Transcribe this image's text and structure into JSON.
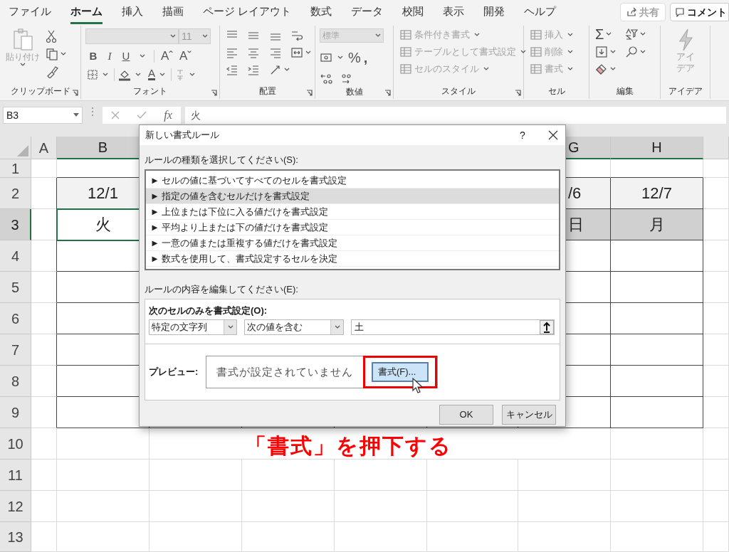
{
  "ribbon_tabs": [
    {
      "label": "ファイル",
      "selected": false
    },
    {
      "label": "ホーム",
      "selected": true
    },
    {
      "label": "挿入",
      "selected": false
    },
    {
      "label": "描画",
      "selected": false
    },
    {
      "label": "ページ レイアウト",
      "selected": false
    },
    {
      "label": "数式",
      "selected": false
    },
    {
      "label": "データ",
      "selected": false
    },
    {
      "label": "校閲",
      "selected": false
    },
    {
      "label": "表示",
      "selected": false
    },
    {
      "label": "開発",
      "selected": false
    },
    {
      "label": "ヘルプ",
      "selected": false
    }
  ],
  "share_button": {
    "label": "共有",
    "disabled": true
  },
  "comment_button": {
    "label": "コメント"
  },
  "ribbon": {
    "clipboard": {
      "paste": {
        "label": "貼り付け",
        "disabled": true
      },
      "group_label": "クリップボード"
    },
    "font": {
      "size": "11",
      "style_buttons": [
        "B",
        "I",
        "U"
      ],
      "size_buttons": [
        "Aˆ",
        "Aˇ"
      ],
      "color_button": "A",
      "group_label": "フォント"
    },
    "alignment": {
      "group_label": "配置"
    },
    "number": {
      "format": "標準",
      "symbols": [
        "%",
        ","
      ],
      "group_label": "数値"
    },
    "styles": {
      "commands": [
        {
          "label": "条件付き書式",
          "disabled": true
        },
        {
          "label": "テーブルとして書式設定",
          "disabled": true
        },
        {
          "label": "セルのスタイル",
          "disabled": true
        }
      ],
      "group_label": "スタイル"
    },
    "cells": {
      "commands": [
        {
          "label": "挿入",
          "disabled": true
        },
        {
          "label": "削除",
          "disabled": true
        },
        {
          "label": "書式",
          "disabled": true
        }
      ],
      "group_label": "セル"
    },
    "editing": {
      "sum": "Σ",
      "group_label": "編集"
    },
    "ideas": {
      "label": "アイデア",
      "disabled": true,
      "group_label": "アイデア"
    }
  },
  "formula_bar": {
    "name_box": "B3",
    "fx_label": "fx",
    "formula": "火"
  },
  "sheet": {
    "columns": [
      {
        "label": "A",
        "selected": false
      },
      {
        "label": "B",
        "selected": true
      },
      {
        "label": "G",
        "selected": true
      },
      {
        "label": "H",
        "selected": true
      }
    ],
    "rows": [
      {
        "label": "1",
        "selected": false
      },
      {
        "label": "2",
        "selected": false,
        "cells": [
          null,
          {
            "text": "12/1",
            "active": false
          },
          {
            "text": "/6",
            "active": false
          },
          {
            "text": "12/7",
            "active": false
          }
        ]
      },
      {
        "label": "3",
        "selected": true,
        "cells": [
          null,
          {
            "text": "火",
            "active": true
          },
          {
            "text": "日",
            "active": false
          },
          {
            "text": "月",
            "active": false
          }
        ]
      },
      {
        "label": "4",
        "selected": false
      },
      {
        "label": "5",
        "selected": false
      },
      {
        "label": "6",
        "selected": false
      },
      {
        "label": "7",
        "selected": false
      },
      {
        "label": "8",
        "selected": false
      },
      {
        "label": "9",
        "selected": false
      },
      {
        "label": "10",
        "selected": false
      },
      {
        "label": "11",
        "selected": false
      },
      {
        "label": "12",
        "selected": false
      },
      {
        "label": "13",
        "selected": false
      }
    ]
  },
  "dialog": {
    "title": "新しい書式ルール",
    "help": "?",
    "rule_type_label": "ルールの種類を選択してください(S):",
    "rule_types": [
      {
        "label": "► セルの値に基づいてすべてのセルを書式設定",
        "selected": false
      },
      {
        "label": "► 指定の値を含むセルだけを書式設定",
        "selected": true
      },
      {
        "label": "► 上位または下位に入る値だけを書式設定",
        "selected": false
      },
      {
        "label": "► 平均より上または下の値だけを書式設定",
        "selected": false
      },
      {
        "label": "► 一意の値または重複する値だけを書式設定",
        "selected": false
      },
      {
        "label": "► 数式を使用して、書式設定するセルを決定",
        "selected": false
      }
    ],
    "edit_label": "ルールの内容を編集してください(E):",
    "condition_label": "次のセルのみを書式設定(O):",
    "condition_type": "特定の文字列",
    "operator": "次の値を含む",
    "value": "土",
    "preview_label": "プレビュー:",
    "preview_text": "書式が設定されていません",
    "format_button": "書式(F)...",
    "ok_button": "OK",
    "cancel_button": "キャンセル"
  },
  "annotation": "「書式」を押下する"
}
